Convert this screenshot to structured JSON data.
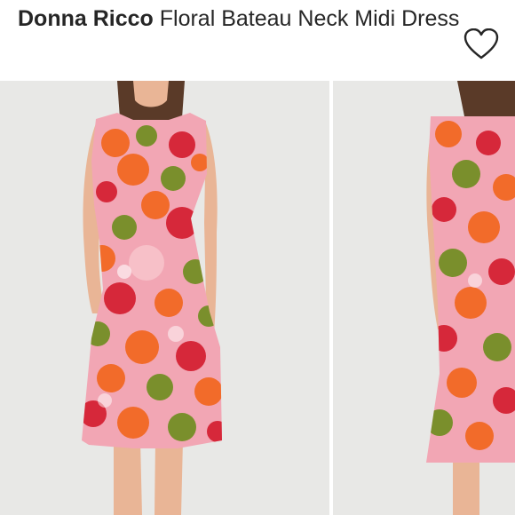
{
  "listing": {
    "brand": "Donna Ricco",
    "product_name": "Floral Bateau Neck Midi Dress"
  },
  "favorite": {
    "icon": "heart-outline-icon"
  },
  "gallery": {
    "images": [
      {
        "subject": "front view of model wearing floral midi dress"
      },
      {
        "subject": "back view of model wearing floral midi dress"
      }
    ]
  },
  "colors": {
    "title_text": "#262626",
    "photo_background": "#e8e8e6",
    "dress_base": "#f2a6b4",
    "flower_orange": "#f26b2a",
    "flower_red": "#d6283a",
    "leaf_green": "#7a8f2c",
    "skin": "#e9b596",
    "hair": "#5a3a28"
  }
}
